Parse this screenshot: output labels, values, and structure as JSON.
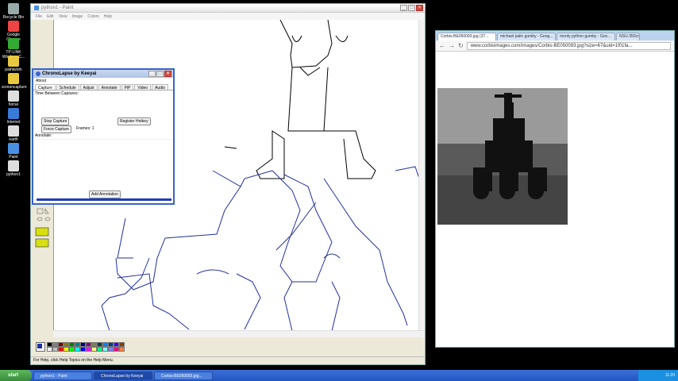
{
  "desktop": {
    "icons": [
      {
        "label": "Recycle Bin",
        "color": "#9aa"
      },
      {
        "label": "Google Chrome",
        "color": "#e44"
      },
      {
        "label": "TP-LINK Wireless C...",
        "color": "#3a3"
      },
      {
        "label": "paintwork",
        "color": "#e8c840"
      },
      {
        "label": "screencapture",
        "color": "#e8c840"
      },
      {
        "label": "horse",
        "color": "#ddd"
      },
      {
        "label": "Internet",
        "color": "#3a7ad8"
      },
      {
        "label": "earth",
        "color": "#ddd"
      },
      {
        "label": "Paint",
        "color": "#4a90e2"
      },
      {
        "label": "python1",
        "color": "#ddd"
      }
    ]
  },
  "paint": {
    "title": "python1 - Paint",
    "menu": [
      "File",
      "Edit",
      "View",
      "Image",
      "Colors",
      "Help"
    ],
    "status": "For Help, click Help Topics on the Help Menu.",
    "palette": [
      "#000000",
      "#808080",
      "#800000",
      "#808000",
      "#008000",
      "#008080",
      "#000080",
      "#800080",
      "#808040",
      "#004040",
      "#0080ff",
      "#004080",
      "#4000ff",
      "#804000",
      "#ffffff",
      "#c0c0c0",
      "#ff0000",
      "#ffff00",
      "#00ff00",
      "#00ffff",
      "#0000ff",
      "#ff00ff",
      "#ffff80",
      "#00ff80",
      "#80ffff",
      "#8080ff",
      "#ff0080",
      "#ff8040"
    ]
  },
  "chrono": {
    "title": "ChronoLapse by Keeyai",
    "about": "About",
    "tabs": [
      "Capture",
      "Schedule",
      "Adjust",
      "Annotate",
      "PiP",
      "Video",
      "Audio"
    ],
    "time_between": "Time Between Captures:",
    "stop": "Stop Capture",
    "force": "Force Capture",
    "frames": "Frames: 1",
    "register": "Register Hotkey",
    "annotate": "Annotate:",
    "add_annotation": "Add Annotation"
  },
  "chrome": {
    "tabs": [
      "Corbis-BE050093.jpg (37...",
      "michael palin gumby - Goog...",
      "monty python gumby - Goo...",
      "NSU-350cc..."
    ],
    "url": "www.corbisimages.com/images/Corbis-BE050093.jpg?size=67&uid=1f01fa..."
  },
  "taskbar": {
    "start": "start",
    "tasks": [
      "python1 - Paint",
      "ChronoLapse by Keeyai",
      "Corbis-BE050093.jpg..."
    ],
    "clock": "11:20"
  }
}
